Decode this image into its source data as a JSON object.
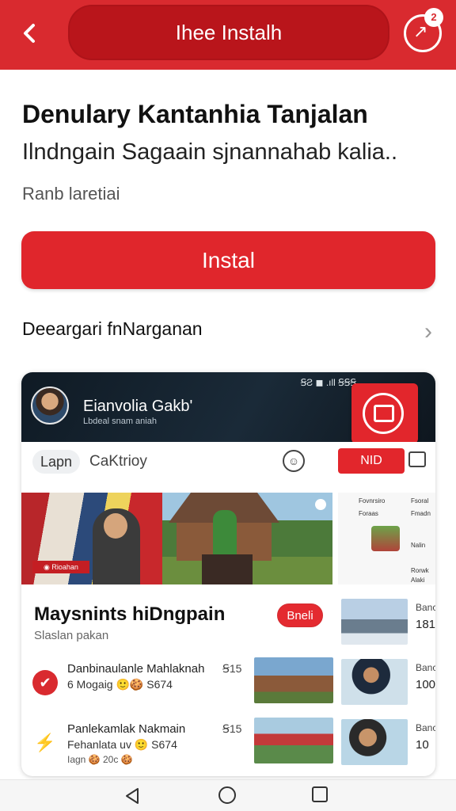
{
  "header": {
    "title": "Ihee Instalh",
    "badge_count": "2"
  },
  "app": {
    "title": "Denulary Kantanhia Tanjalan",
    "subtitle": "Ilndngain Sagaain sjnannahab kalia..",
    "meta": "Ranb laretiai",
    "install_label": "Instal",
    "more_label": "Deeargari fnNarganan"
  },
  "preview": {
    "status_text": "ꞨƧ ◼ .ıll ꞨꞨꞨ",
    "channel_name": "Eianvolia Gakb'",
    "channel_sub": "Lbdeal snam aniah",
    "chip_primary": "Lapn",
    "chip_secondary": "CaKtrioy",
    "nd_label": "NID",
    "banner_tag": "◉ Rioahan",
    "side_mini": [
      "Fovnrsiro",
      "Fsoral",
      "Foraas",
      "Fmadn",
      "Nalin",
      "Rorwk",
      "Alaki"
    ],
    "section_title": "Maysnints hiDngpain",
    "section_sub": "Slaslan pakan",
    "section_btn": "Bneli",
    "rows": [
      {
        "line1": "Danbinaulanle Mahlaknah",
        "line2": "6 Mogaig 🙂🍪 S674",
        "line3": "",
        "tag": "Ꞩ15"
      },
      {
        "line1": "Panlekamlak Nakmain",
        "line2": "Fehanlata  uv 🙂 S674",
        "line3": "Iagn 🍪 20c 🍪",
        "tag": "Ꞩ15"
      }
    ],
    "side_items": [
      {
        "a": "Banc",
        "b": "181"
      },
      {
        "a": "Banc",
        "b": "100"
      },
      {
        "a": "Banc",
        "b": "10"
      }
    ]
  },
  "colors": {
    "brand_red": "#d92a2f"
  }
}
